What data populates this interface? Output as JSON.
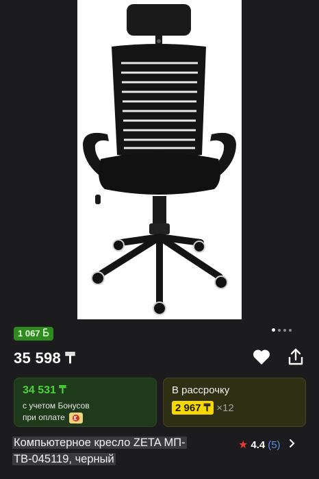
{
  "product": {
    "image_alt": "office chair photo",
    "title": "Компьютерное кресло ZETA МП-ТВ-045119, черный",
    "rating": "4.4",
    "reviews": "(5)"
  },
  "bonus_badge": {
    "amount": "1 067",
    "currency_icon": "bonus-b"
  },
  "carousel": {
    "total_dots": 4,
    "active_dot": 1
  },
  "price": {
    "value": "35 598 ₸"
  },
  "bonus_card": {
    "price": "34 531 ₸",
    "line1": "с учетом Бонусов",
    "line2": "при оплате"
  },
  "credit_card": {
    "title": "В рассрочку",
    "monthly": "2 967 ₸",
    "multiplier": "×12"
  },
  "colors": {
    "background": "#1c1c1e",
    "bonus_green": "#4cd137",
    "monthly_yellow": "#f5d800",
    "star_red": "#e53935",
    "link_blue": "#5b8def"
  },
  "icons": [
    "heart-icon",
    "share-icon",
    "star-icon",
    "chevron-right-icon",
    "kaspi-icon"
  ]
}
